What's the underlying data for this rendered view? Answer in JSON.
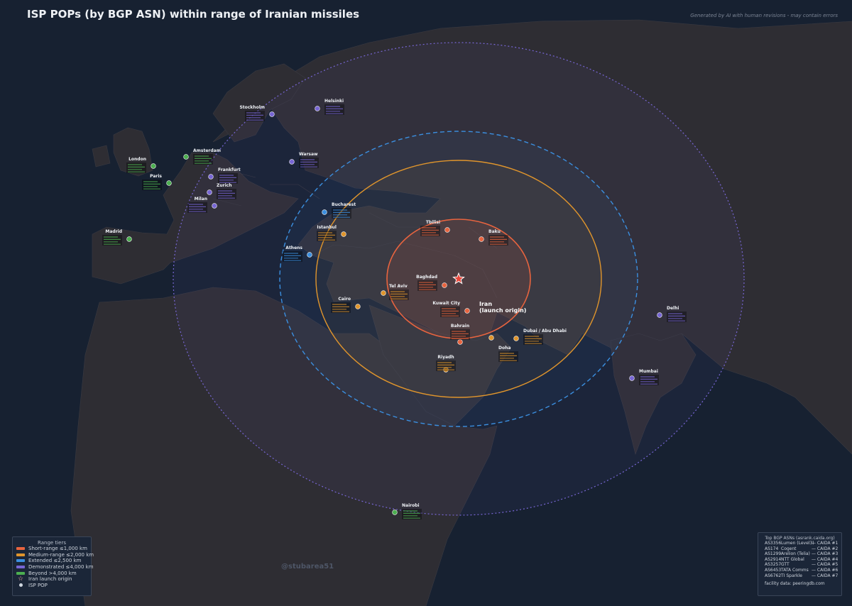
{
  "title": "ISP POPs (by BGP ASN) within range of Iranian missiles",
  "credit": "Generated by AI with human revisions - may contain errors",
  "watermark": "@stubarea51",
  "colors": {
    "background": "#172131",
    "land": "#2e2d33",
    "short": "#e8643f",
    "medium": "#e0952c",
    "extended": "#3b8fe0",
    "demonstrated": "#7766d4",
    "beyond": "#4caf50"
  },
  "legend": {
    "title": "Range tiers",
    "items": [
      {
        "label": "Short-range  ≤1,000 km",
        "color": "#e8643f"
      },
      {
        "label": "Medium-range  ≤2,000 km",
        "color": "#e0952c"
      },
      {
        "label": "Extended  ≤2,500 km",
        "color": "#3b8fe0"
      },
      {
        "label": "Demonstrated  ≤4,000 km",
        "color": "#7766d4"
      },
      {
        "label": "Beyond  >4,000 km",
        "color": "#4caf50"
      }
    ],
    "origin_label": "Iran launch origin",
    "pop_label": "ISP POP"
  },
  "asn_box": {
    "title": "Top BGP ASNs  (asrank.caida.org)",
    "rows": [
      {
        "asn": "AS3356",
        "name": "Lumen (Level3)",
        "rank": "— CAIDA #1"
      },
      {
        "asn": "AS174",
        "name": "Cogent",
        "rank": "— CAIDA #2"
      },
      {
        "asn": "AS1299",
        "name": "Arelion (Telia)",
        "rank": "— CAIDA #3"
      },
      {
        "asn": "AS2914",
        "name": "NTT Global",
        "rank": "— CAIDA #4"
      },
      {
        "asn": "AS3257",
        "name": "GTT",
        "rank": "— CAIDA #5"
      },
      {
        "asn": "AS6453",
        "name": "TATA Comms",
        "rank": "— CAIDA #6"
      },
      {
        "asn": "AS6762",
        "name": "TI Sparkle",
        "rank": "— CAIDA #7"
      }
    ],
    "footer": "facility data: peeringdb.com"
  },
  "origin": {
    "name": "Iran",
    "sublabel": "(launch origin)"
  },
  "cities": [
    {
      "name": "Baghdad",
      "tier": "short"
    },
    {
      "name": "Kuwait City",
      "tier": "short"
    },
    {
      "name": "Tbilisi",
      "tier": "short"
    },
    {
      "name": "Baku",
      "tier": "short"
    },
    {
      "name": "Bahrain",
      "tier": "short"
    },
    {
      "name": "Doha",
      "tier": "medium"
    },
    {
      "name": "Dubai / Abu Dhabi",
      "tier": "medium"
    },
    {
      "name": "Riyadh",
      "tier": "medium"
    },
    {
      "name": "Tel Aviv",
      "tier": "medium"
    },
    {
      "name": "Cairo",
      "tier": "medium"
    },
    {
      "name": "Istanbul",
      "tier": "medium"
    },
    {
      "name": "Bucharest",
      "tier": "extended"
    },
    {
      "name": "Athens",
      "tier": "extended"
    },
    {
      "name": "Warsaw",
      "tier": "demonstrated"
    },
    {
      "name": "Helsinki",
      "tier": "demonstrated"
    },
    {
      "name": "Stockholm",
      "tier": "demonstrated"
    },
    {
      "name": "Frankfurt",
      "tier": "demonstrated"
    },
    {
      "name": "Zurich",
      "tier": "demonstrated"
    },
    {
      "name": "Milan",
      "tier": "demonstrated"
    },
    {
      "name": "Delhi",
      "tier": "demonstrated"
    },
    {
      "name": "Mumbai",
      "tier": "demonstrated"
    },
    {
      "name": "Amsterdam",
      "tier": "beyond"
    },
    {
      "name": "London",
      "tier": "beyond"
    },
    {
      "name": "Paris",
      "tier": "beyond"
    },
    {
      "name": "Madrid",
      "tier": "beyond"
    },
    {
      "name": "Nairobi",
      "tier": "beyond"
    }
  ]
}
